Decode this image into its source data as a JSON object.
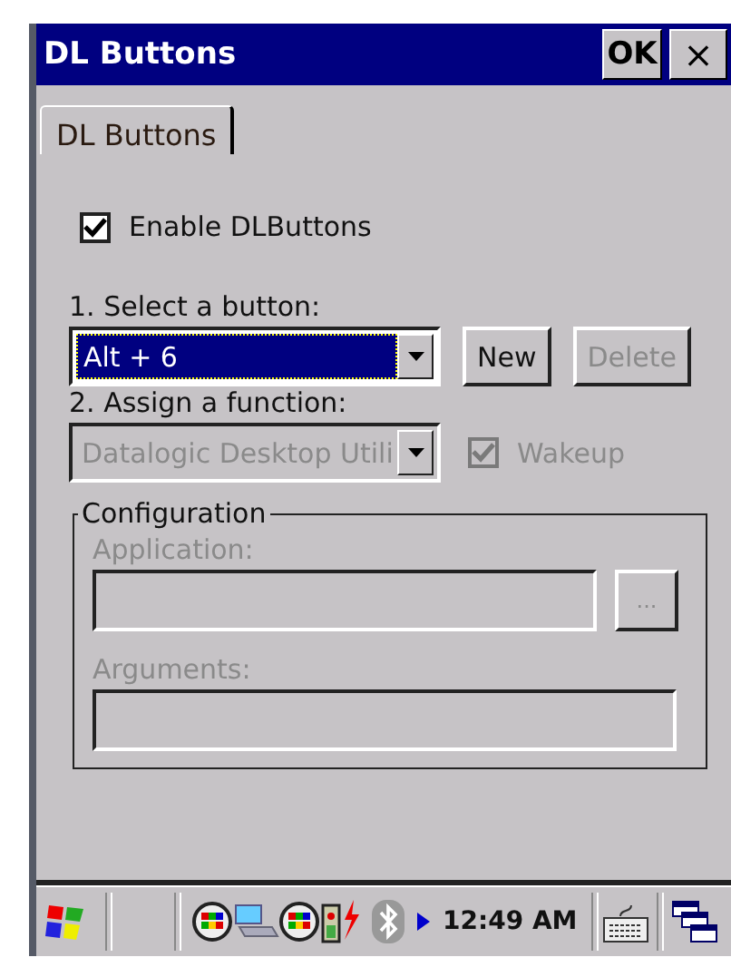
{
  "window": {
    "title": "DL Buttons",
    "title_buttons": [
      {
        "label": "OK",
        "kind": "ok"
      },
      {
        "label": "×",
        "kind": "close"
      }
    ]
  },
  "tabs": [
    {
      "label": "DL Buttons",
      "selected": true
    }
  ],
  "enable": {
    "label": "Enable DLButtons",
    "checked": true
  },
  "select_label": "1. Select a button:",
  "button_select": {
    "value": "Alt + 6",
    "selected": true
  },
  "actions": [
    {
      "label": "New",
      "disabled": false
    },
    {
      "label": "Delete",
      "disabled": true
    }
  ],
  "assign_label": "2. Assign a function:",
  "function_select": {
    "value": "Datalogic Desktop Utili",
    "disabled": true
  },
  "wakeup": {
    "label": "Wakeup",
    "checked": true,
    "disabled": true
  },
  "configuration": {
    "title": "Configuration",
    "application_label": "Application:",
    "browse": "...",
    "arguments_label": "Arguments:",
    "disabled": true
  },
  "taskbar": {
    "time": "12:49 AM"
  }
}
